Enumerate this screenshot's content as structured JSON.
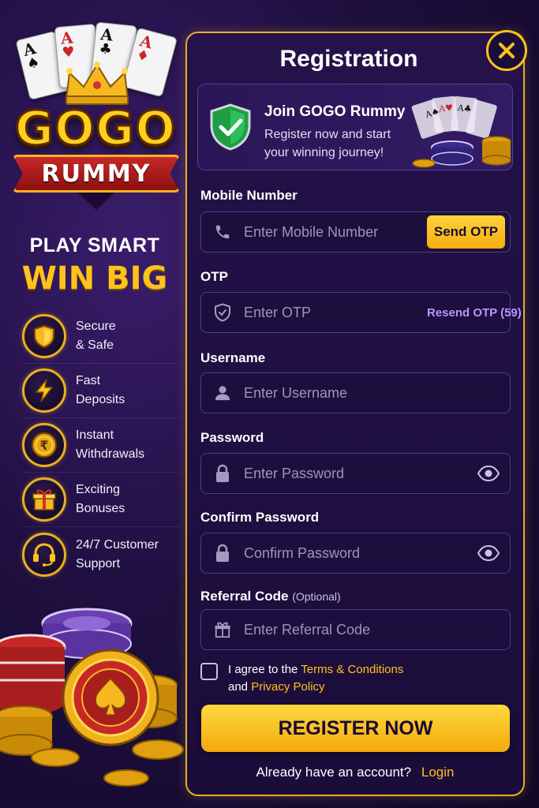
{
  "brand": {
    "logo_top": "GOGO",
    "logo_bottom": "RUMMY",
    "card_ranks": [
      "A",
      "A",
      "A",
      "A"
    ]
  },
  "tagline": {
    "line1": "PLAY SMART",
    "line2": "WIN BIG"
  },
  "features": [
    {
      "icon": "shield-icon",
      "text": "Secure\n& Safe"
    },
    {
      "icon": "lightning-icon",
      "text": "Fast\nDeposits"
    },
    {
      "icon": "rupee-coin-icon",
      "text": "Instant\nWithdrawals"
    },
    {
      "icon": "gift-icon",
      "text": "Exciting\nBonuses"
    },
    {
      "icon": "headset-icon",
      "text": "24/7 Customer\nSupport"
    }
  ],
  "form": {
    "title": "Registration",
    "banner_title": "Join GOGO Rummy",
    "banner_subtitle": "Register now and start your winning journey!",
    "mobile": {
      "label": "Mobile Number",
      "placeholder": "Enter Mobile Number",
      "button": "Send OTP"
    },
    "otp": {
      "label": "OTP",
      "placeholder": "Enter OTP",
      "resend": "Resend OTP (59)"
    },
    "username": {
      "label": "Username",
      "placeholder": "Enter Username"
    },
    "password": {
      "label": "Password",
      "placeholder": "Enter Password"
    },
    "confirm": {
      "label": "Confirm Password",
      "placeholder": "Confirm Password"
    },
    "referral": {
      "label": "Referral Code",
      "optional": "(Optional)",
      "placeholder": "Enter Referral Code"
    },
    "agree": {
      "prefix": "I agree to the ",
      "terms": "Terms & Conditions",
      "middle": "and ",
      "privacy": "Privacy Policy",
      "checked": false
    },
    "register_button": "REGISTER NOW",
    "login_prompt": "Already have an account?",
    "login_link": "Login"
  },
  "colors": {
    "accent": "#ffc21a",
    "background": "#1e0f3f",
    "panel": "#1b0d3a",
    "link_purple": "#b596ff"
  }
}
